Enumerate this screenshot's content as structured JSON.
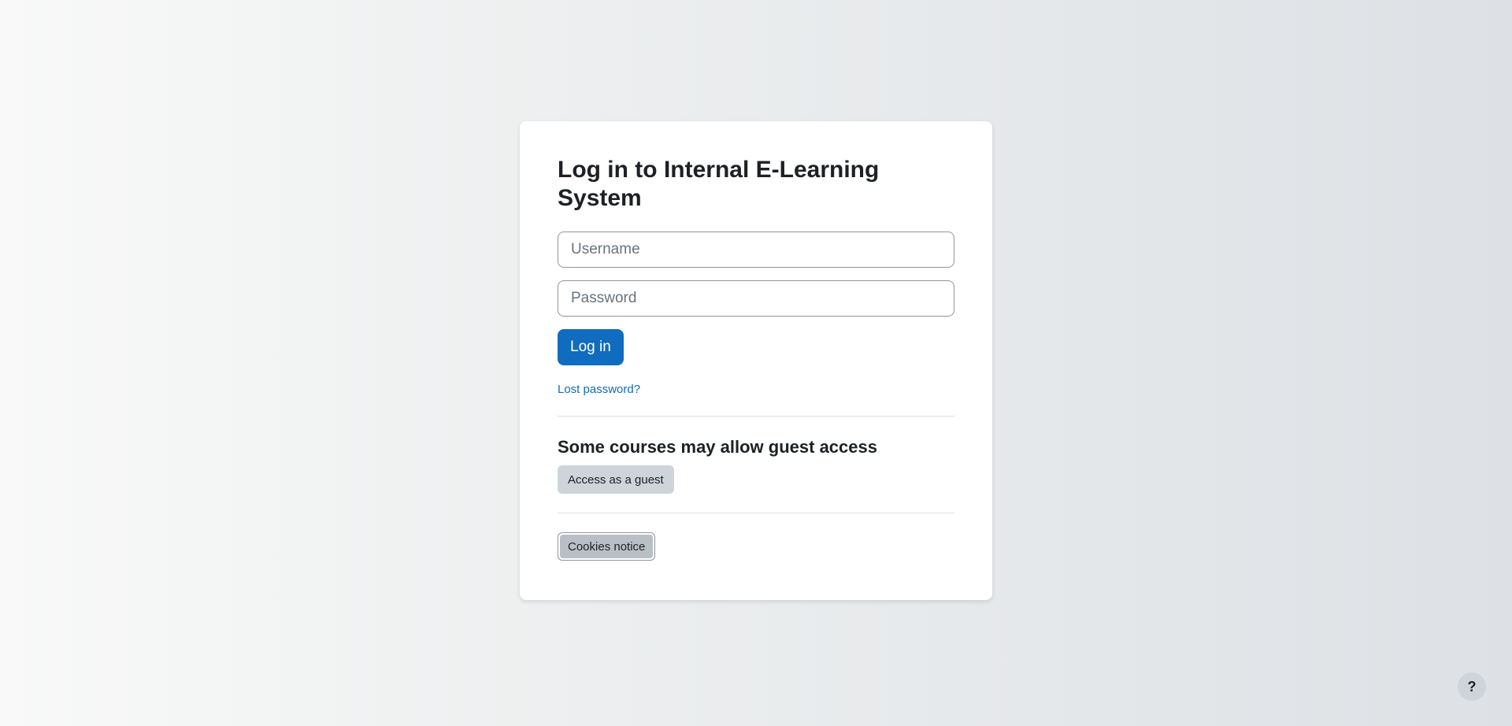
{
  "login": {
    "title": "Log in to Internal E-Learning System",
    "username_placeholder": "Username",
    "password_placeholder": "Password",
    "login_button": "Log in",
    "lost_password_link": "Lost password?"
  },
  "guest": {
    "heading": "Some courses may allow guest access",
    "button": "Access as a guest"
  },
  "cookies": {
    "button": "Cookies notice"
  },
  "help": {
    "icon": "question-mark-icon",
    "label": "?"
  },
  "colors": {
    "primary": "#0f6cbf",
    "secondary_button": "#ced4da",
    "text": "#1d2125"
  }
}
